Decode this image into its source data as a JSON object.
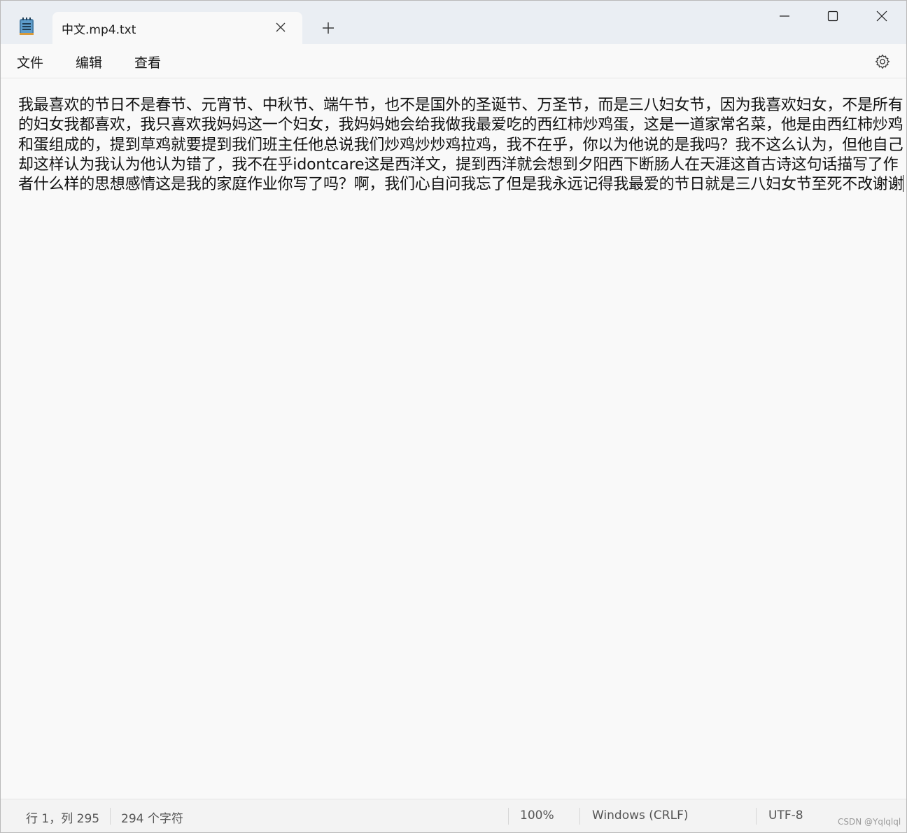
{
  "window": {
    "tab_title": "中文.mp4.txt",
    "app_icon": "notepad-icon",
    "new_tab_icon": "plus-icon",
    "tab_close_icon": "close-icon",
    "controls": [
      "minimize-icon",
      "maximize-icon",
      "close-icon"
    ]
  },
  "menu": {
    "file": "文件",
    "edit": "编辑",
    "view": "查看",
    "settings_icon": "gear-icon"
  },
  "editor": {
    "content": "我最喜欢的节日不是春节、元宵节、中秋节、端午节，也不是国外的圣诞节、万圣节，而是三八妇女节，因为我喜欢妇女，不是所有的妇女我都喜欢，我只喜欢我妈妈这一个妇女，我妈妈她会给我做我最爱吃的西红柿炒鸡蛋，这是一道家常名菜，他是由西红柿炒鸡和蛋组成的，提到草鸡就要提到我们班主任他总说我们炒鸡炒炒鸡拉鸡，我不在乎，你以为他说的是我吗？我不这么认为，但他自己却这样认为我认为他认为错了，我不在乎idontcare这是西洋文，提到西洋就会想到夕阳西下断肠人在天涯这首古诗这句话描写了作者什么样的思想感情这是我的家庭作业你写了吗？啊，我们心自问我忘了但是我永远记得我最爱的节日就是三八妇女节至死不改谢谢"
  },
  "status": {
    "position": "行 1，列 295",
    "char_count": "294 个字符",
    "zoom": "100%",
    "line_ending": "Windows (CRLF)",
    "encoding": "UTF-8",
    "watermark": "CSDN @Yqlqlql"
  }
}
